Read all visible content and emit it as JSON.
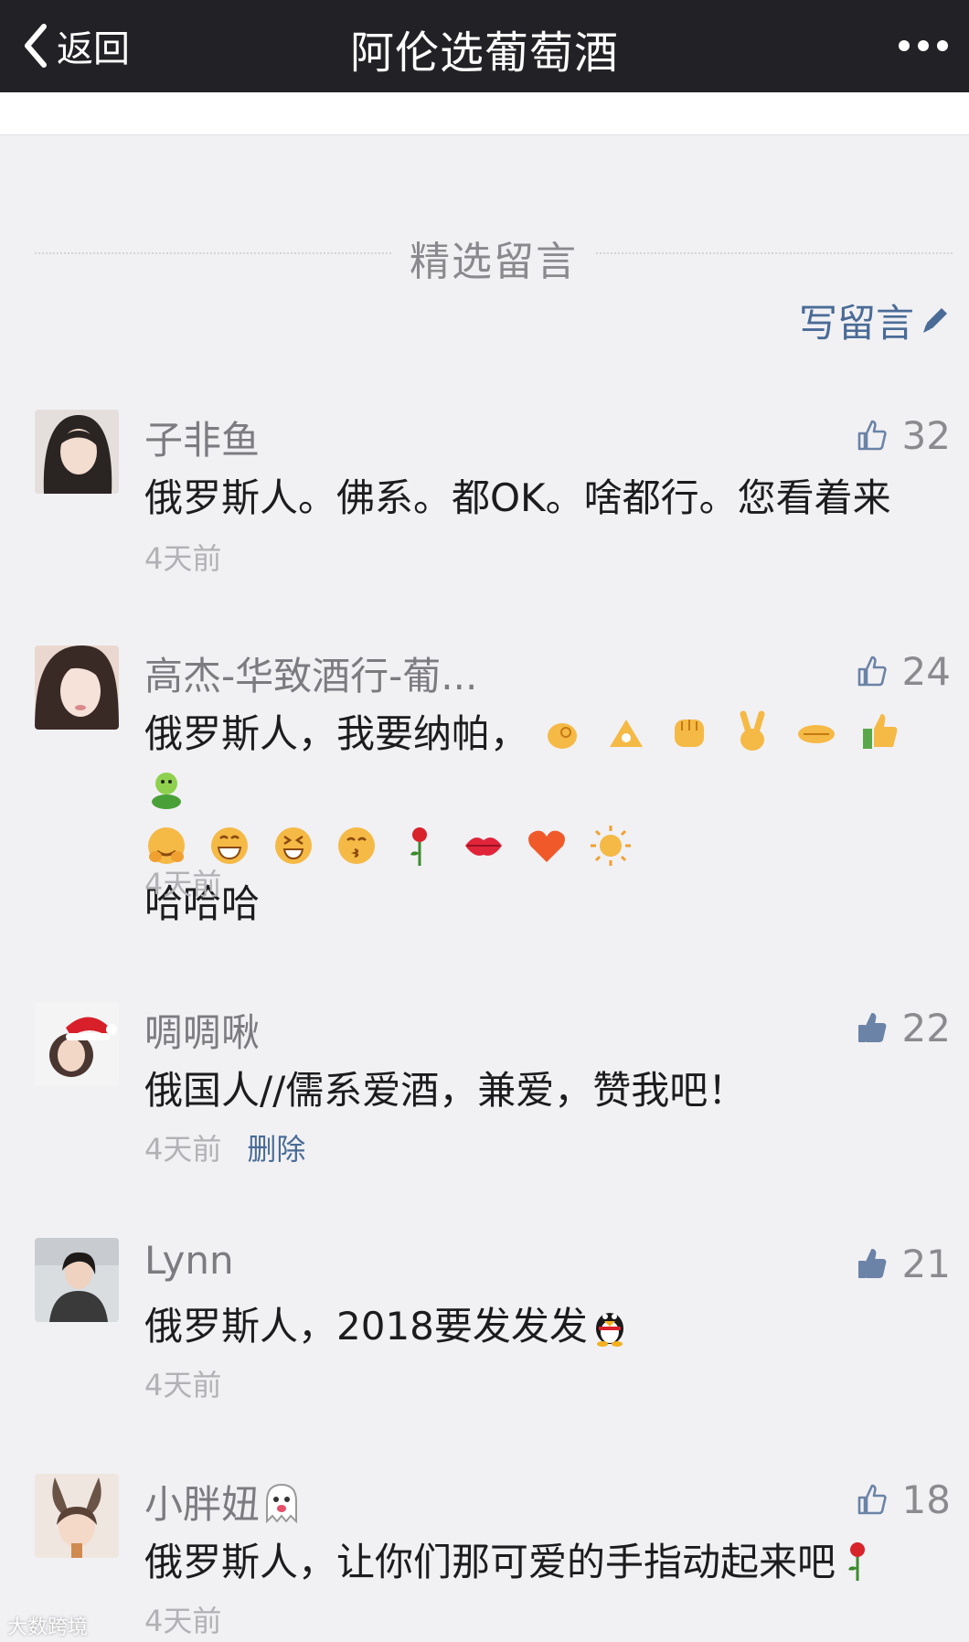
{
  "nav": {
    "back_label": "返回",
    "title": "阿伦选葡萄酒"
  },
  "section": {
    "title": "精选留言",
    "write_label": "写留言"
  },
  "comments": [
    {
      "name": "子非鱼",
      "likes": "32",
      "text": "俄罗斯人。佛系。都OK。啥都行。您看着来",
      "time": "4天前"
    },
    {
      "name": "高杰-华致酒行-葡...",
      "likes": "24",
      "text": "俄罗斯人，我要纳帕，",
      "text_line3": "哈哈哈",
      "time": "4天前"
    },
    {
      "name": "啁啁啾",
      "likes": "22",
      "text": "俄国人//儒系爱酒，兼爱，赞我吧！",
      "time": "4天前",
      "delete_label": "删除"
    },
    {
      "name": "Lynn",
      "likes": "21",
      "text": "俄罗斯人，2018要发发发",
      "time": "4天前"
    },
    {
      "name": "小胖妞",
      "likes": "18",
      "text": "俄罗斯人，让你们那可爱的手指动起来吧",
      "time": "4天前"
    }
  ],
  "watermark": "大数跨境"
}
